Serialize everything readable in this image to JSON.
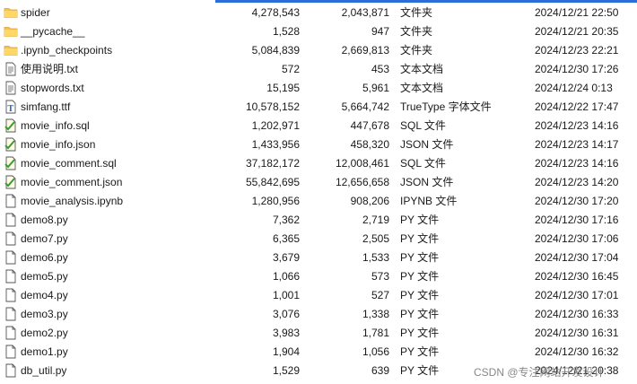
{
  "files": [
    {
      "name": "spider",
      "size": "4,278,543",
      "compressed": "2,043,871",
      "type": "文件夹",
      "date": "2024/12/21 22:50",
      "icon": "folder-icon"
    },
    {
      "name": "__pycache__",
      "size": "1,528",
      "compressed": "947",
      "type": "文件夹",
      "date": "2024/12/21 20:35",
      "icon": "folder-icon"
    },
    {
      "name": ".ipynb_checkpoints",
      "size": "5,084,839",
      "compressed": "2,669,813",
      "type": "文件夹",
      "date": "2024/12/23 22:21",
      "icon": "folder-icon"
    },
    {
      "name": "使用说明.txt",
      "size": "572",
      "compressed": "453",
      "type": "文本文档",
      "date": "2024/12/30 17:26",
      "icon": "text-file-icon"
    },
    {
      "name": "stopwords.txt",
      "size": "15,195",
      "compressed": "5,961",
      "type": "文本文档",
      "date": "2024/12/24 0:13",
      "icon": "text-file-icon"
    },
    {
      "name": "simfang.ttf",
      "size": "10,578,152",
      "compressed": "5,664,742",
      "type": "TrueType 字体文件",
      "date": "2024/12/22 17:47",
      "icon": "font-file-icon"
    },
    {
      "name": "movie_info.sql",
      "size": "1,202,971",
      "compressed": "447,678",
      "type": "SQL 文件",
      "date": "2024/12/23 14:16",
      "icon": "sql-file-icon"
    },
    {
      "name": "movie_info.json",
      "size": "1,433,956",
      "compressed": "458,320",
      "type": "JSON 文件",
      "date": "2024/12/23 14:17",
      "icon": "json-file-icon"
    },
    {
      "name": "movie_comment.sql",
      "size": "37,182,172",
      "compressed": "12,008,461",
      "type": "SQL 文件",
      "date": "2024/12/23 14:16",
      "icon": "sql-file-icon"
    },
    {
      "name": "movie_comment.json",
      "size": "55,842,695",
      "compressed": "12,656,658",
      "type": "JSON 文件",
      "date": "2024/12/23 14:20",
      "icon": "json-file-icon"
    },
    {
      "name": "movie_analysis.ipynb",
      "size": "1,280,956",
      "compressed": "908,206",
      "type": "IPYNB 文件",
      "date": "2024/12/30 17:20",
      "icon": "generic-file-icon"
    },
    {
      "name": "demo8.py",
      "size": "7,362",
      "compressed": "2,719",
      "type": "PY 文件",
      "date": "2024/12/30 17:16",
      "icon": "generic-file-icon"
    },
    {
      "name": "demo7.py",
      "size": "6,365",
      "compressed": "2,505",
      "type": "PY 文件",
      "date": "2024/12/30 17:06",
      "icon": "generic-file-icon"
    },
    {
      "name": "demo6.py",
      "size": "3,679",
      "compressed": "1,533",
      "type": "PY 文件",
      "date": "2024/12/30 17:04",
      "icon": "generic-file-icon"
    },
    {
      "name": "demo5.py",
      "size": "1,066",
      "compressed": "573",
      "type": "PY 文件",
      "date": "2024/12/30 16:45",
      "icon": "generic-file-icon"
    },
    {
      "name": "demo4.py",
      "size": "1,001",
      "compressed": "527",
      "type": "PY 文件",
      "date": "2024/12/30 17:01",
      "icon": "generic-file-icon"
    },
    {
      "name": "demo3.py",
      "size": "3,076",
      "compressed": "1,338",
      "type": "PY 文件",
      "date": "2024/12/30 16:33",
      "icon": "generic-file-icon"
    },
    {
      "name": "demo2.py",
      "size": "3,983",
      "compressed": "1,781",
      "type": "PY 文件",
      "date": "2024/12/30 16:31",
      "icon": "generic-file-icon"
    },
    {
      "name": "demo1.py",
      "size": "1,904",
      "compressed": "1,056",
      "type": "PY 文件",
      "date": "2024/12/30 16:32",
      "icon": "generic-file-icon"
    },
    {
      "name": "db_util.py",
      "size": "1,529",
      "compressed": "639",
      "type": "PY 文件",
      "date": "2024/12/21 20:38",
      "icon": "generic-file-icon"
    }
  ],
  "watermark": "CSDN @专注网站开发设计"
}
